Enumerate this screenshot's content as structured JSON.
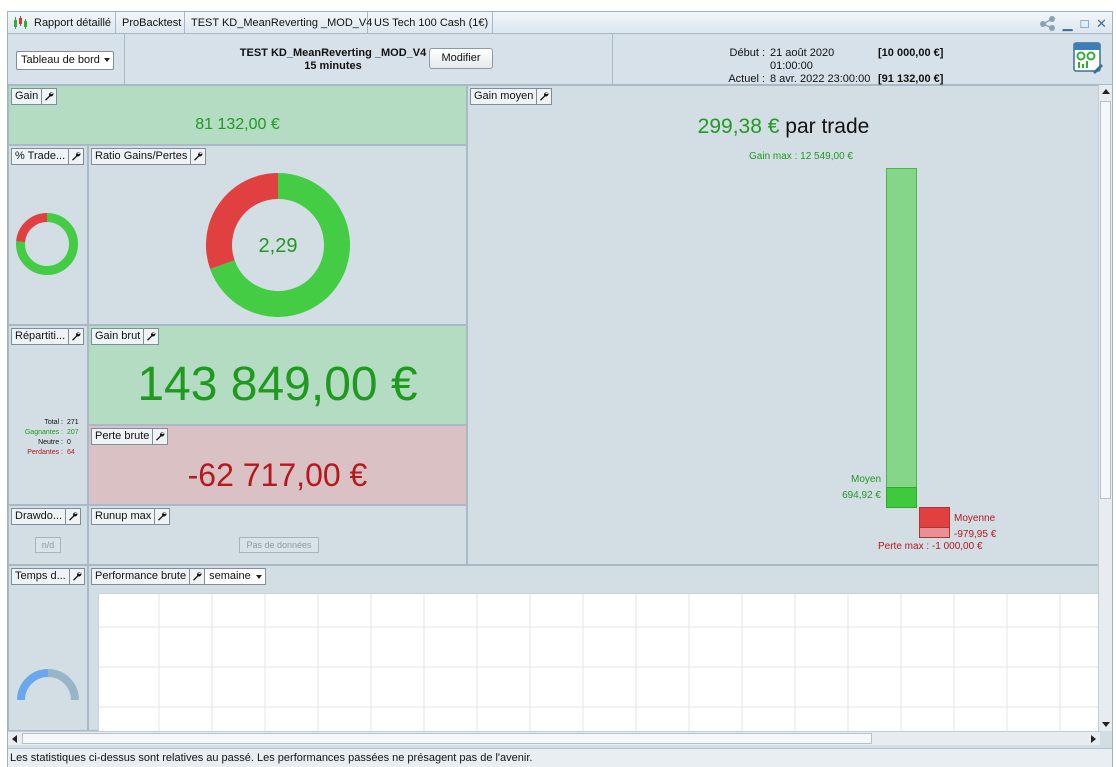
{
  "tabs": [
    {
      "label": "Rapport détaillé"
    },
    {
      "label": "ProBacktest"
    },
    {
      "label": "TEST KD_MeanReverting _MOD_V4"
    },
    {
      "label": "US Tech 100 Cash (1€)"
    }
  ],
  "header": {
    "view_select": "Tableau de bord",
    "strategy_name": "TEST KD_MeanReverting _MOD_V4",
    "timeframe": "15 minutes",
    "modify_label": "Modifier",
    "start_label": "Début :",
    "start_value": "21 août 2020 01:00:00",
    "start_capital": "[10 000,00 €]",
    "current_label": "Actuel :",
    "current_value": "8 avr. 2022 23:00:00",
    "current_capital": "[91 132,00 €]"
  },
  "panels": {
    "gain": {
      "title": "Gain",
      "value": "81 132,00 €"
    },
    "pct_trades": {
      "title": "% Trade...",
      "winning_fraction": 0.764
    },
    "ratio": {
      "title": "Ratio Gains/Pertes",
      "value": "2,29",
      "gain_fraction": 0.696
    },
    "repartition": {
      "title": "Répartiti...",
      "rows": [
        {
          "label": "Total :",
          "value": "271"
        },
        {
          "label": "Gagnantes :",
          "value": "207"
        },
        {
          "label": "Neutre :",
          "value": "0"
        },
        {
          "label": "Perdantes :",
          "value": "64"
        }
      ]
    },
    "gain_brut": {
      "title": "Gain brut",
      "value": "143 849,00 €"
    },
    "perte_brute": {
      "title": "Perte brute",
      "value": "-62 717,00 €"
    },
    "drawdown": {
      "title": "Drawdo...",
      "nd_label": "n/d"
    },
    "runup": {
      "title": "Runup max",
      "no_data_label": "Pas de données"
    },
    "gain_moyen": {
      "title": "Gain moyen",
      "value": "299,38 €",
      "unit": "par trade",
      "gain_max_label": "Gain max : 12 549,00 €",
      "moyen_label": "Moyen",
      "moyen_value": "694,92 €",
      "moyenne_label": "Moyenne",
      "moyenne_value": "-979,95 €",
      "perte_max_label": "Perte max : -1 000,00 €"
    },
    "temps": {
      "title": "Temps d..."
    },
    "performance": {
      "title": "Performance brute",
      "period": "semaine"
    }
  },
  "footer": "Les statistiques ci-dessus sont relatives au passé. Les performances passées ne présagent pas de l'avenir.",
  "colors": {
    "green": "#1f9a1f",
    "donut_green": "#44cc44",
    "donut_red": "#e04040",
    "red": "#b5191d",
    "accent": "#3d6f98"
  }
}
